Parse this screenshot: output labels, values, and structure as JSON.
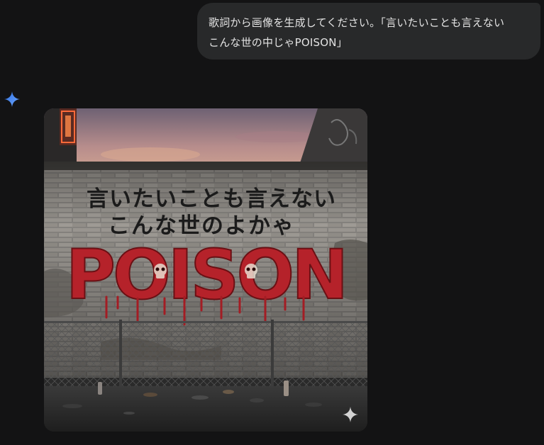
{
  "chat": {
    "user_message": "歌詞から画像を生成してください。「言いたいことも言えない\nこんな世の中じゃPOISON」"
  },
  "assistant": {
    "avatar_icon": "gemini-sparkle-icon",
    "accent_color": "#4a8ff7"
  },
  "generated_image": {
    "graffiti_line1": "言いたいことも言えない",
    "graffiti_line2": "こんな世のよかゃ",
    "graffiti_word": "POISON",
    "watermark_icon": "sparkle-watermark-icon"
  }
}
